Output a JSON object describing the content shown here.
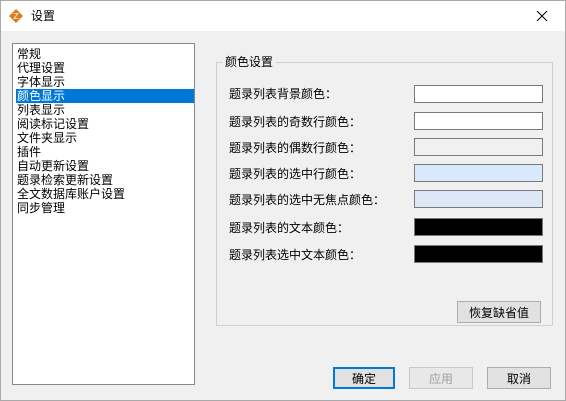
{
  "window": {
    "title": "设置",
    "icon": "app-logo-icon"
  },
  "sidebar": {
    "items": [
      {
        "label": "常规"
      },
      {
        "label": "代理设置"
      },
      {
        "label": "字体显示"
      },
      {
        "label": "颜色显示",
        "selected": true
      },
      {
        "label": "列表显示"
      },
      {
        "label": "阅读标记设置"
      },
      {
        "label": "文件夹显示"
      },
      {
        "label": "插件"
      },
      {
        "label": "自动更新设置"
      },
      {
        "label": "题录检索更新设置"
      },
      {
        "label": "全文数据库账户设置"
      },
      {
        "label": "同步管理"
      }
    ]
  },
  "color_settings": {
    "group_label": "颜色设置",
    "rows": [
      {
        "label": "题录列表背景颜色：",
        "color": "#ffffff"
      },
      {
        "label": "题录列表的奇数行颜色：",
        "color": "#ffffff"
      },
      {
        "label": "题录列表的偶数行颜色：",
        "color": "#f0f0f0"
      },
      {
        "label": "题录列表的选中行颜色：",
        "color": "#d9e9fd"
      },
      {
        "label": "题录列表的选中无焦点颜色：",
        "color": "#dce8f8"
      },
      {
        "label": "题录列表的文本颜色：",
        "color": "#000000"
      },
      {
        "label": "题录列表选中文本颜色：",
        "color": "#000000"
      }
    ],
    "restore_label": "恢复缺省值"
  },
  "footer": {
    "ok_label": "确定",
    "apply_label": "应用",
    "cancel_label": "取消"
  },
  "colors": {
    "selection": "#0078d7",
    "logo": "#e07a1f"
  }
}
